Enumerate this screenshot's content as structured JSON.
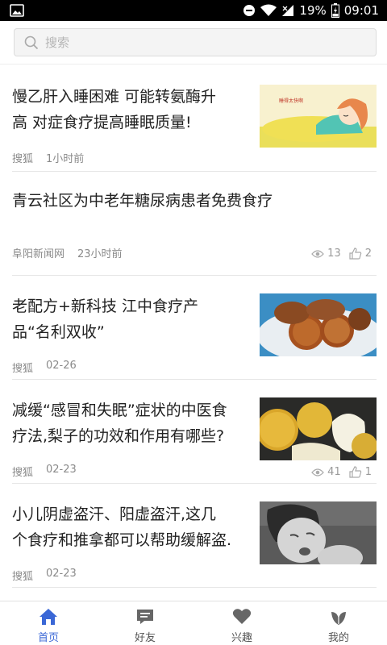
{
  "status_bar": {
    "battery": "19%",
    "time": "09:01"
  },
  "search": {
    "placeholder": "搜索"
  },
  "articles": [
    {
      "title_line1": "慢乙肝入睡困难 可能转氨酶升",
      "title_line2": "高 对症食疗提高睡眠质量!",
      "source": "搜狐",
      "time": "1小时前",
      "image_caption": "睡得太快啊"
    },
    {
      "title_line1": "青云社区为中老年糖尿病患者免费食疗",
      "source": "阜阳新闻网",
      "time": "23小时前",
      "views": "13",
      "likes": "2"
    },
    {
      "title_line1": "老配方+新科技 江中食疗产",
      "title_line2": "品“名利双收”",
      "source": "搜狐",
      "time": "02-26"
    },
    {
      "title_line1": "减缓“感冒和失眠”症状的中医食",
      "title_line2": "疗法,梨子的功效和作用有哪些?",
      "source": "搜狐",
      "time": "02-23",
      "views": "41",
      "likes": "1"
    },
    {
      "title_line1": "小儿阴虚盗汗、阳虚盗汗,这几",
      "title_line2": "个食疗和推拿都可以帮助缓解盗.",
      "source": "搜狐",
      "time": "02-23"
    }
  ],
  "tabs": [
    {
      "label": "首页",
      "icon": "home-icon",
      "active": true
    },
    {
      "label": "好友",
      "icon": "chat-icon",
      "active": false
    },
    {
      "label": "兴趣",
      "icon": "heart-icon",
      "active": false
    },
    {
      "label": "我的",
      "icon": "leaf-icon",
      "active": false
    }
  ],
  "colors": {
    "accent": "#3a67d6",
    "inactive_icon": "#666666"
  }
}
